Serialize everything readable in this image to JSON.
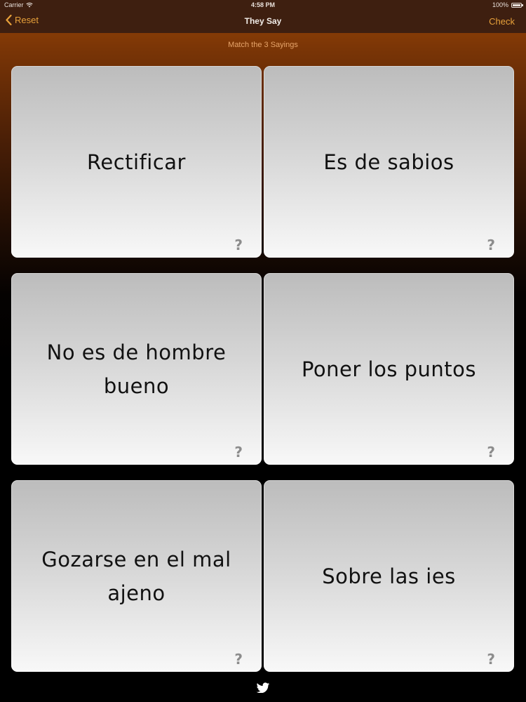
{
  "status": {
    "carrier": "Carrier",
    "time": "4:58 PM",
    "battery": "100%"
  },
  "nav": {
    "back_label": "Reset",
    "title": "They Say",
    "check_label": "Check"
  },
  "subtitle": "Match the 3 Sayings",
  "cards": [
    {
      "text": "Rectificar",
      "hint": "?"
    },
    {
      "text": "Es de sabios",
      "hint": "?"
    },
    {
      "text": "No es de hombre bueno",
      "hint": "?"
    },
    {
      "text": "Poner los puntos",
      "hint": "?"
    },
    {
      "text": "Gozarse en el mal ajeno",
      "hint": "?"
    },
    {
      "text": "Sobre las ies",
      "hint": "?"
    }
  ],
  "colors": {
    "accent": "#e8a13a",
    "bar": "#3e1f10",
    "subtitle": "#e6a46a"
  },
  "icons": {
    "wifi": "wifi-icon",
    "battery": "battery-icon",
    "back": "chevron-left-icon",
    "footer": "bird-icon"
  }
}
